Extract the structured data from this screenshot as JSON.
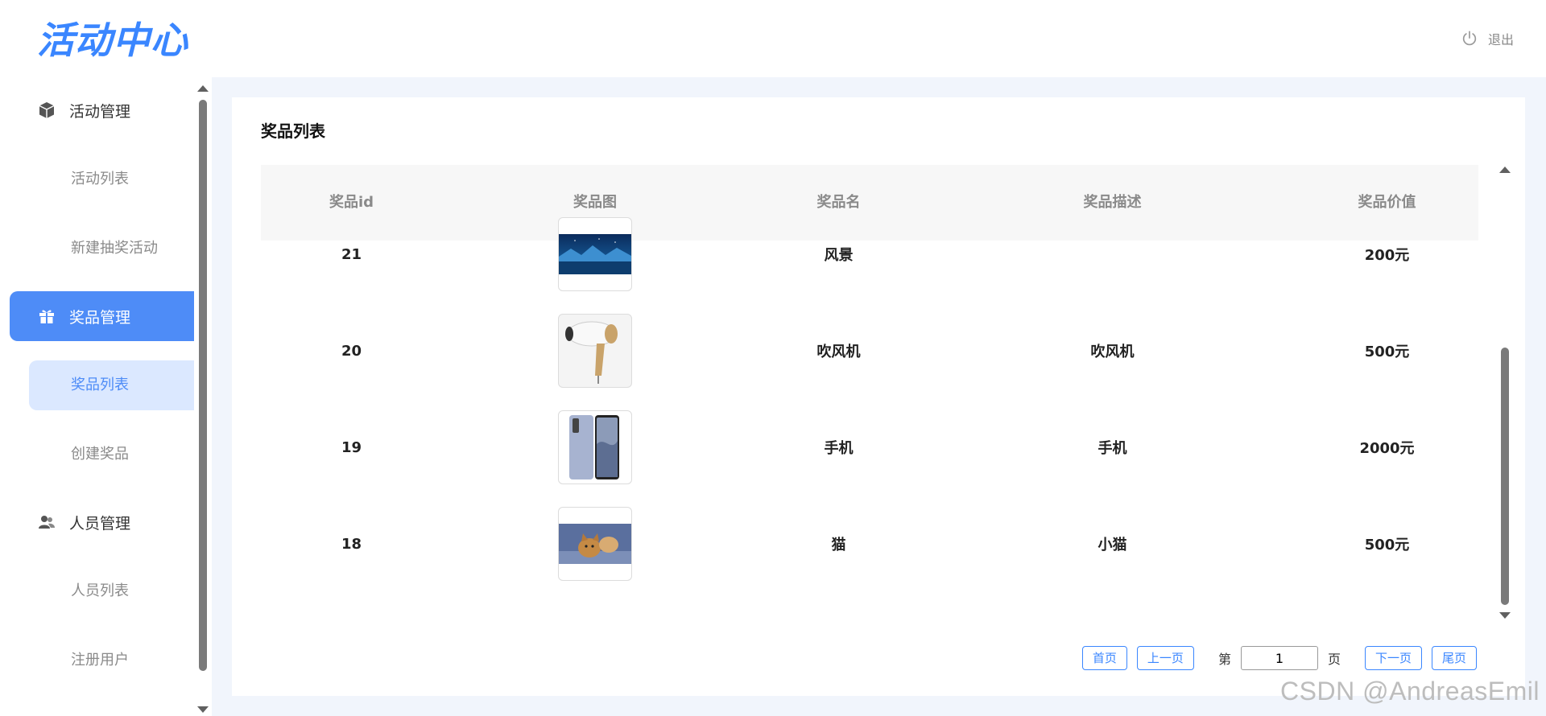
{
  "header": {
    "logo_text": "活动中心",
    "logout_label": "退出"
  },
  "sidebar": {
    "groups": [
      {
        "label": "活动管理",
        "icon": "cube-icon",
        "items": [
          "活动列表",
          "新建抽奖活动"
        ]
      },
      {
        "label": "奖品管理",
        "icon": "gift-icon",
        "items": [
          "奖品列表",
          "创建奖品"
        ],
        "active": true
      },
      {
        "label": "人员管理",
        "icon": "users-icon",
        "items": [
          "人员列表",
          "注册用户"
        ]
      }
    ],
    "active_item": "奖品列表"
  },
  "main": {
    "title": "奖品列表",
    "table": {
      "columns": [
        "奖品id",
        "奖品图",
        "奖品名",
        "奖品描述",
        "奖品价值"
      ],
      "rows": [
        {
          "id": "21",
          "image": "landscape-image",
          "name": "风景",
          "desc": "",
          "value": "200元"
        },
        {
          "id": "20",
          "image": "hairdryer-image",
          "name": "吹风机",
          "desc": "吹风机",
          "value": "500元"
        },
        {
          "id": "19",
          "image": "phone-image",
          "name": "手机",
          "desc": "手机",
          "value": "2000元"
        },
        {
          "id": "18",
          "image": "cat-image",
          "name": "猫",
          "desc": "小猫",
          "value": "500元"
        }
      ]
    },
    "pagination": {
      "first": "首页",
      "prev": "上一页",
      "page_prefix": "第",
      "page_value": "1",
      "page_suffix": "页",
      "next": "下一页",
      "last": "尾页"
    }
  },
  "watermark": "CSDN @AndreasEmil",
  "colors": {
    "accent": "#4e8cf7",
    "accent_light": "#dbe8ff",
    "bg": "#f1f5fc"
  }
}
